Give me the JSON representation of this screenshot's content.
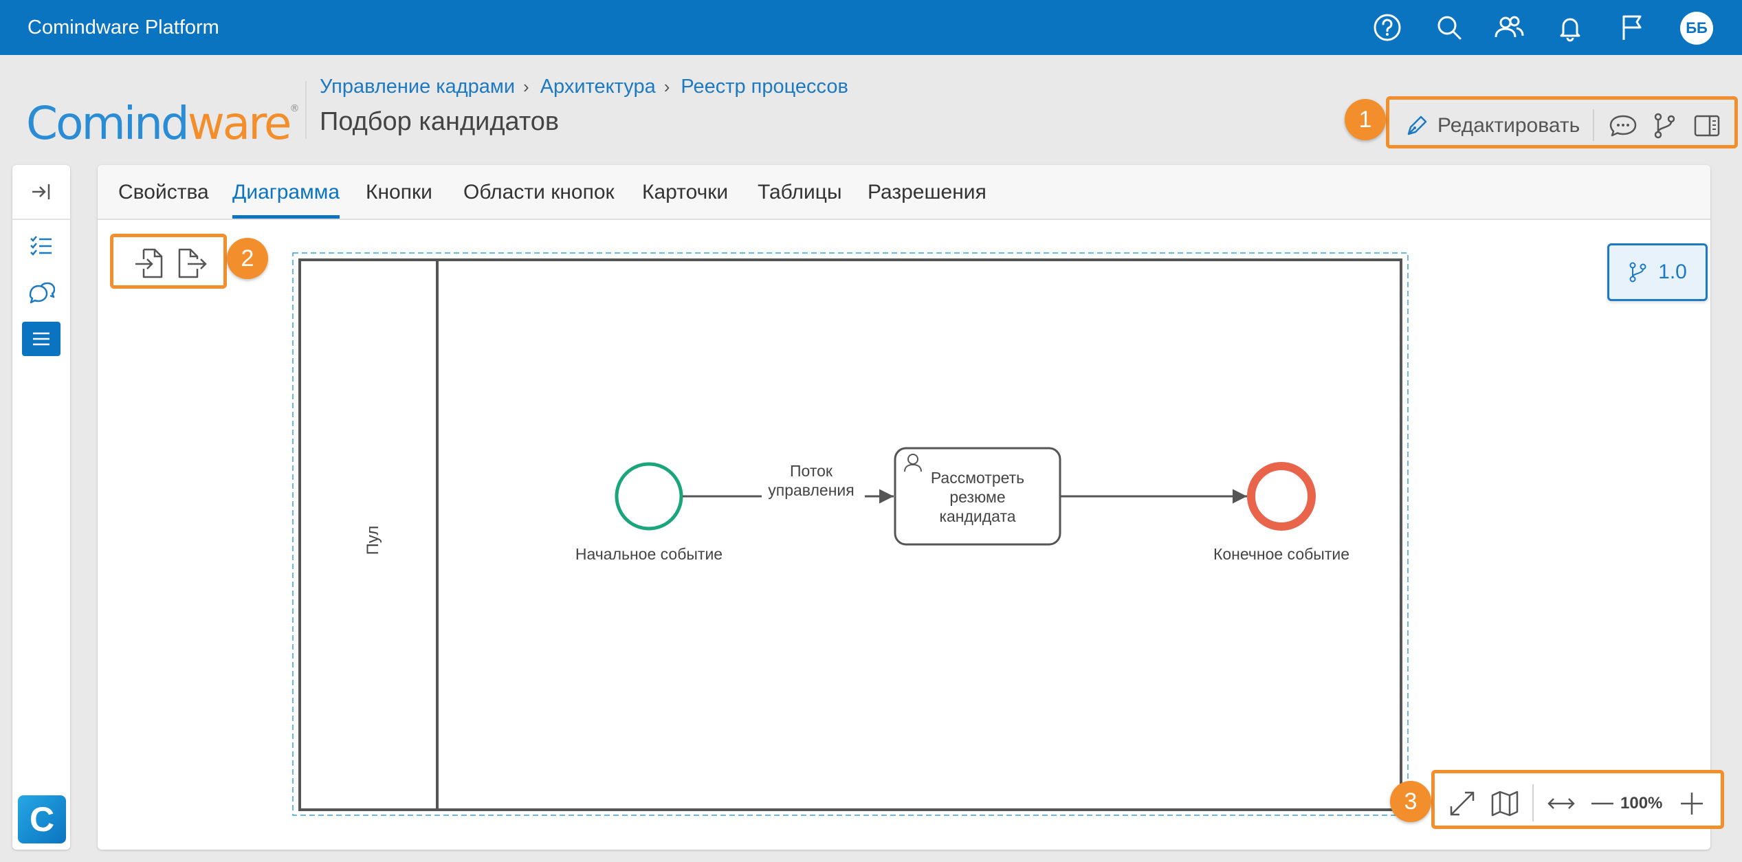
{
  "topbar": {
    "app_title": "Comindware Platform",
    "icons": [
      "help-icon",
      "search-icon",
      "users-icon",
      "bell-icon",
      "flag-icon"
    ],
    "avatar_initials": "ББ"
  },
  "header": {
    "logo_part1": "Comind",
    "logo_part2": "ware",
    "logo_mark": "®",
    "breadcrumb": [
      "Управление кадрами",
      "Архитектура",
      "Реестр процессов"
    ],
    "breadcrumb_sep": "›",
    "title": "Подбор кандидатов"
  },
  "actions": {
    "badge": "1",
    "edit_label": "Редактировать",
    "icons": [
      "comment-icon",
      "branch-icon",
      "side-panel-icon"
    ]
  },
  "left_panel": {
    "icons": [
      "collapse-icon",
      "checklist-icon",
      "chat-icon",
      "menu-icon"
    ],
    "app_logo": "C"
  },
  "tabs": [
    {
      "label": "Свойства",
      "active": false
    },
    {
      "label": "Диаграмма",
      "active": true
    },
    {
      "label": "Кнопки",
      "active": false
    },
    {
      "label": "Области кнопок",
      "active": false
    },
    {
      "label": "Карточки",
      "active": false
    },
    {
      "label": "Таблицы",
      "active": false
    },
    {
      "label": "Разрешения",
      "active": false
    }
  ],
  "import_export": {
    "badge": "2",
    "icons": [
      "import-icon",
      "export-icon"
    ]
  },
  "version": {
    "label": "1.0"
  },
  "diagram": {
    "pool_label": "Пул",
    "start_event": "Начальное событие",
    "flow_label_line1": "Поток",
    "flow_label_line2": "управления",
    "task_line1": "Рассмотреть",
    "task_line2": "резюме",
    "task_line3": "кандидата",
    "end_event": "Конечное событие",
    "colors": {
      "start": "#1aa57a",
      "end": "#e8644a",
      "lines": "#555555",
      "selection": "#3aa0d8"
    }
  },
  "zoom": {
    "badge": "3",
    "value": "100%",
    "icons": [
      "fullscreen-icon",
      "minimap-icon",
      "fit-width-icon",
      "zoom-out-icon",
      "zoom-in-icon"
    ]
  },
  "accent_color": "#0a74c0",
  "highlight_color": "#f28f2c"
}
